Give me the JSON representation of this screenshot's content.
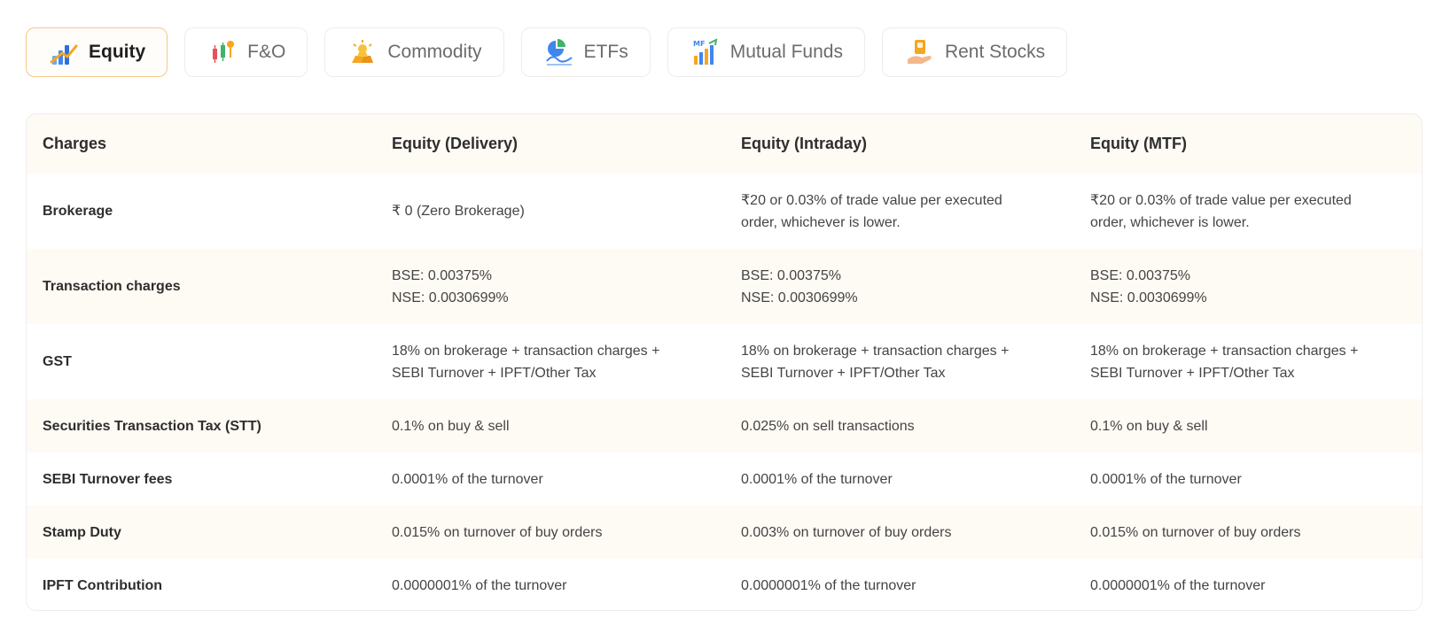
{
  "tabs": [
    {
      "label": "Equity",
      "icon": "equity-chart-icon",
      "active": true
    },
    {
      "label": "F&O",
      "icon": "fno-candles-icon",
      "active": false
    },
    {
      "label": "Commodity",
      "icon": "commodity-gold-icon",
      "active": false
    },
    {
      "label": "ETFs",
      "icon": "etf-pie-icon",
      "active": false
    },
    {
      "label": "Mutual Funds",
      "icon": "mutual-funds-bars-icon",
      "active": false
    },
    {
      "label": "Rent Stocks",
      "icon": "rent-stocks-hand-icon",
      "active": false
    }
  ],
  "table": {
    "headers": [
      "Charges",
      "Equity (Delivery)",
      "Equity (Intraday)",
      "Equity (MTF)"
    ],
    "rows": [
      {
        "label": "Brokerage",
        "cells": [
          [
            "₹ 0 (Zero Brokerage)"
          ],
          [
            "₹20 or 0.03% of trade value per executed",
            "order, whichever is lower."
          ],
          [
            "₹20 or 0.03% of trade value per executed",
            "order, whichever is lower."
          ]
        ]
      },
      {
        "label": "Transaction charges",
        "cells": [
          [
            "BSE: 0.00375%",
            "NSE: 0.0030699%"
          ],
          [
            "BSE: 0.00375%",
            "NSE: 0.0030699%"
          ],
          [
            "BSE: 0.00375%",
            "NSE: 0.0030699%"
          ]
        ]
      },
      {
        "label": "GST",
        "cells": [
          [
            "18% on brokerage + transaction charges +",
            "SEBI Turnover + IPFT/Other Tax"
          ],
          [
            "18% on brokerage + transaction charges +",
            "SEBI Turnover + IPFT/Other Tax"
          ],
          [
            "18% on brokerage + transaction charges +",
            "SEBI Turnover + IPFT/Other Tax"
          ]
        ]
      },
      {
        "label": "Securities Transaction Tax (STT)",
        "cells": [
          [
            "0.1% on buy & sell"
          ],
          [
            "0.025% on sell transactions"
          ],
          [
            "0.1% on buy & sell"
          ]
        ]
      },
      {
        "label": "SEBI Turnover fees",
        "cells": [
          [
            "0.0001% of the turnover"
          ],
          [
            "0.0001% of the turnover"
          ],
          [
            "0.0001% of the turnover"
          ]
        ]
      },
      {
        "label": "Stamp Duty",
        "cells": [
          [
            "0.015% on turnover of buy orders"
          ],
          [
            "0.003% on turnover of buy orders"
          ],
          [
            "0.015% on turnover of buy orders"
          ]
        ]
      },
      {
        "label": "IPFT Contribution",
        "cells": [
          [
            "0.0000001% of the turnover"
          ],
          [
            "0.0000001% of the turnover"
          ],
          [
            "0.0000001% of the turnover"
          ]
        ]
      }
    ]
  },
  "colors": {
    "accent_border": "#f3c98b",
    "row_alt_bg": "#fefaf4",
    "text": "#3a3a3a"
  }
}
